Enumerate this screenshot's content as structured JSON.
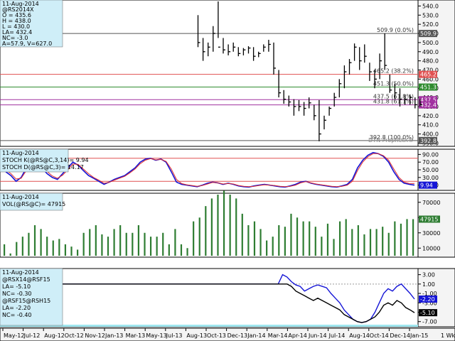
{
  "colors": {
    "price": "#000000",
    "stoch_k": "#1515d6",
    "stoch_d": "#e03030",
    "volume": "#2e7d32",
    "spread1": "#1515d6",
    "spread2": "#000000",
    "fib_0": "#555555",
    "fib_382": "#e05050",
    "fib_50": "#2e8b2e",
    "fib_618": "#a0309f",
    "fib_100": "#555555",
    "info_bg": "#cfeef8",
    "axis_bg": "#f4f4f4"
  },
  "price_panel": {
    "date": "11-Aug-2014",
    "symbol": "@RS2014X",
    "open": "O = 435.6",
    "high": "H = 438.0",
    "low": "L = 430.0",
    "last": "LA= 432.4",
    "net_change": "NC= -3.0",
    "open_interest": "A=57.9, V=627.0",
    "watermark": "DTN ProphetX®",
    "fib_levels": [
      {
        "value": 509.9,
        "label": "509.9 (0.0%)",
        "badge": "509.9",
        "color_key": "fib_0"
      },
      {
        "value": 465.2,
        "label": "465.2 (38.2%)",
        "badge": "465.2",
        "color_key": "fib_382"
      },
      {
        "value": 451.3,
        "label": "451.3 (50.0%)",
        "badge": "451.3",
        "color_key": "fib_50"
      },
      {
        "value": 437.5,
        "label": "437.5 (61.8%)",
        "badge": "437.5",
        "color_key": "fib_618"
      },
      {
        "value": 431.8,
        "label": "431.8 (61.1%)",
        "badge": "432.4",
        "color_key": "fib_618"
      },
      {
        "value": 392.8,
        "label": "392.8 (100.0%)",
        "badge": "392.8",
        "color_key": "fib_100"
      }
    ],
    "y_ticks": [
      "540.0",
      "530.0",
      "520.0",
      "510.0",
      "500.0",
      "490.0",
      "480.0",
      "470.0",
      "460.0",
      "450.0",
      "440.0",
      "430.0",
      "420.0",
      "410.0",
      "400.0",
      "390.0"
    ]
  },
  "stoch_panel": {
    "date": "11-Aug-2014",
    "k_label": "STOCH K(@RS@C,3,14)= 9.94",
    "d_label": "STOCH D(@RS@C,3)= 14.17",
    "k_badge": "9.94",
    "y_ticks": [
      "90.00",
      "70.00",
      "50.00",
      "30.00",
      "10.00"
    ]
  },
  "volume_panel": {
    "date": "11-Aug-2014",
    "label": "VOL(@RS@C)= 47915",
    "badge": "47915",
    "y_ticks": [
      "70000",
      "50000",
      "30000",
      "10000"
    ]
  },
  "spread_panel": {
    "date": "11-Aug-2014",
    "s1_symbol": "@RSX14@RSF15",
    "s1_last": "LA= -5.10",
    "s1_nc": "NC= -0.30",
    "s2_symbol": "@RSF15@RSH15",
    "s2_last": "LA= -2.20",
    "s2_nc": "NC= -0.40",
    "badge1": "-2.20",
    "badge2": "-5.10",
    "y_ticks": [
      "3.00",
      "1.00",
      "-1.00",
      "-3.00",
      "-5.00",
      "-7.00"
    ]
  },
  "x_axis": {
    "labels": [
      "May-12",
      "Jul-12",
      "Aug-12",
      "Oct-12",
      "Nov-12",
      "Jan-13",
      "Mar-13",
      "May-13",
      "Jul-13",
      "Aug-13",
      "Oct-13",
      "Dec-13",
      "Jan-14",
      "Mar-14",
      "Apr-14",
      "Jun-14",
      "Jul-14",
      "Aug-14",
      "Oct-14",
      "Dec-14",
      "Jan-15"
    ],
    "period": "1 Wk"
  },
  "chart_data": [
    {
      "type": "ohlc",
      "title": "@RS2014X",
      "ylim": [
        388,
        545
      ],
      "x": [
        25,
        26,
        27,
        28,
        29,
        30,
        31,
        32,
        33,
        34,
        35,
        36,
        37,
        38,
        39,
        40,
        41,
        42,
        43,
        44,
        45,
        46,
        47,
        48,
        49,
        50,
        51,
        52,
        53,
        54,
        55,
        56,
        57,
        58,
        59,
        60,
        61,
        62,
        63,
        64,
        65,
        66,
        67,
        68,
        69
      ],
      "high": [
        530,
        505,
        500,
        518,
        545,
        505,
        498,
        500,
        495,
        494,
        496,
        495,
        490,
        498,
        503,
        500,
        470,
        448,
        442,
        438,
        437,
        435,
        440,
        432,
        437,
        420,
        430,
        445,
        460,
        475,
        482,
        499,
        495,
        498,
        478,
        470,
        488,
        510,
        465,
        455,
        450,
        443,
        443,
        440,
        438
      ],
      "low": [
        495,
        480,
        485,
        490,
        505,
        488,
        486,
        490,
        485,
        486,
        488,
        480,
        484,
        490,
        490,
        465,
        440,
        433,
        430,
        420,
        425,
        420,
        428,
        415,
        392,
        405,
        420,
        430,
        440,
        450,
        465,
        480,
        470,
        478,
        458,
        450,
        460,
        470,
        445,
        438,
        430,
        432,
        432,
        428,
        430
      ],
      "close": [
        500,
        490,
        495,
        510,
        495,
        492,
        490,
        495,
        488,
        492,
        494,
        485,
        488,
        495,
        498,
        472,
        445,
        438,
        435,
        430,
        430,
        428,
        434,
        420,
        400,
        415,
        428,
        440,
        455,
        468,
        478,
        495,
        480,
        485,
        468,
        460,
        480,
        475,
        448,
        445,
        438,
        438,
        440,
        432,
        432
      ]
    },
    {
      "type": "line",
      "title": "Stochastic",
      "ylim": [
        0,
        100
      ],
      "series": [
        {
          "name": "STOCH K",
          "color_key": "stoch_k",
          "values": [
            45,
            35,
            20,
            30,
            55,
            58,
            62,
            55,
            40,
            30,
            25,
            40,
            55,
            70,
            62,
            48,
            35,
            28,
            20,
            12,
            18,
            25,
            30,
            35,
            45,
            55,
            70,
            78,
            80,
            75,
            78,
            70,
            45,
            18,
            12,
            10,
            8,
            6,
            10,
            15,
            18,
            16,
            12,
            15,
            12,
            8,
            6,
            5,
            8,
            10,
            12,
            10,
            8,
            6,
            5,
            8,
            12,
            18,
            20,
            15,
            12,
            10,
            8,
            6,
            5,
            8,
            12,
            25,
            55,
            75,
            88,
            95,
            92,
            85,
            70,
            45,
            25,
            15,
            12,
            9.94
          ]
        },
        {
          "name": "STOCH D",
          "color_key": "stoch_d",
          "values": [
            50,
            40,
            26,
            28,
            48,
            56,
            60,
            58,
            46,
            34,
            28,
            36,
            50,
            65,
            64,
            52,
            40,
            30,
            23,
            15,
            17,
            23,
            28,
            33,
            42,
            52,
            66,
            75,
            79,
            76,
            77,
            72,
            52,
            25,
            14,
            11,
            9,
            7,
            9,
            13,
            17,
            16,
            13,
            14,
            13,
            9,
            7,
            6,
            7,
            9,
            11,
            10,
            9,
            7,
            6,
            7,
            10,
            16,
            19,
            16,
            13,
            11,
            9,
            7,
            6,
            7,
            10,
            20,
            48,
            70,
            84,
            92,
            92,
            87,
            75,
            52,
            30,
            18,
            14,
            14.17
          ]
        }
      ]
    },
    {
      "type": "bar",
      "title": "Volume",
      "ylim": [
        0,
        80000
      ],
      "values": [
        15000,
        3000,
        18000,
        25000,
        30000,
        40000,
        35000,
        25000,
        20000,
        22000,
        15000,
        12000,
        8000,
        30000,
        35000,
        40000,
        28000,
        25000,
        35000,
        40000,
        30000,
        30000,
        40000,
        30000,
        25000,
        25000,
        30000,
        15000,
        35000,
        15000,
        10000,
        45000,
        50000,
        65000,
        75000,
        80000,
        85000,
        80000,
        75000,
        55000,
        40000,
        45000,
        35000,
        20000,
        25000,
        40000,
        38000,
        55000,
        50000,
        45000,
        45000,
        38000,
        25000,
        42000,
        22000,
        45000,
        48000,
        35000,
        40000,
        28000,
        35000,
        35000,
        38000,
        30000,
        45000,
        42000,
        48000,
        47915
      ]
    },
    {
      "type": "line",
      "title": "Calendar Spreads",
      "ylim": [
        -7.5,
        4
      ],
      "series": [
        {
          "name": "@RSX14@RSF15",
          "color_key": "spread1",
          "values": [
            1,
            1,
            1,
            1,
            1,
            1,
            1,
            1,
            1,
            1,
            1,
            1,
            1,
            1,
            1,
            1,
            1,
            1,
            1,
            1,
            1,
            1,
            1,
            1,
            1,
            1,
            1,
            1,
            1,
            1,
            1,
            1,
            1,
            1,
            1,
            1,
            1,
            1,
            1,
            1,
            1,
            1,
            1,
            1,
            1,
            1,
            1,
            1,
            1,
            1,
            1,
            1,
            1,
            1,
            1,
            1,
            1,
            1,
            1,
            1,
            1,
            1,
            1,
            3,
            2.5,
            1.5,
            0.8,
            0.5,
            -0.5,
            0,
            0.5,
            0.8,
            0.5,
            0.2,
            -1,
            -2,
            -3,
            -4.5,
            -5.5,
            -6.5,
            -7,
            -7.2,
            -7,
            -6.5,
            -5,
            -3,
            -1,
            0,
            -0.5,
            0.5,
            1,
            0,
            -1,
            -2.2
          ]
        },
        {
          "name": "@RSF15@RSH15",
          "color_key": "spread2",
          "values": [
            1,
            1,
            1,
            1,
            1,
            1,
            1,
            1,
            1,
            1,
            1,
            1,
            1,
            1,
            1,
            1,
            1,
            1,
            1,
            1,
            1,
            1,
            1,
            1,
            1,
            1,
            1,
            1,
            1,
            1,
            1,
            1,
            1,
            1,
            1,
            1,
            1,
            1,
            1,
            1,
            1,
            1,
            1,
            1,
            1,
            1,
            1,
            1,
            1,
            1,
            1,
            1,
            1,
            1,
            1,
            1,
            1,
            1,
            1,
            1,
            1,
            1,
            1,
            1,
            1,
            0.5,
            -0.5,
            -1,
            -1.5,
            -2,
            -2.5,
            -2,
            -2.5,
            -3,
            -3.5,
            -4,
            -4.5,
            -5.5,
            -6,
            -6.5,
            -7,
            -7.2,
            -7,
            -6.5,
            -6,
            -5,
            -3.5,
            -3,
            -3.5,
            -2.5,
            -3,
            -4,
            -4.5,
            -5.1
          ]
        }
      ]
    }
  ]
}
